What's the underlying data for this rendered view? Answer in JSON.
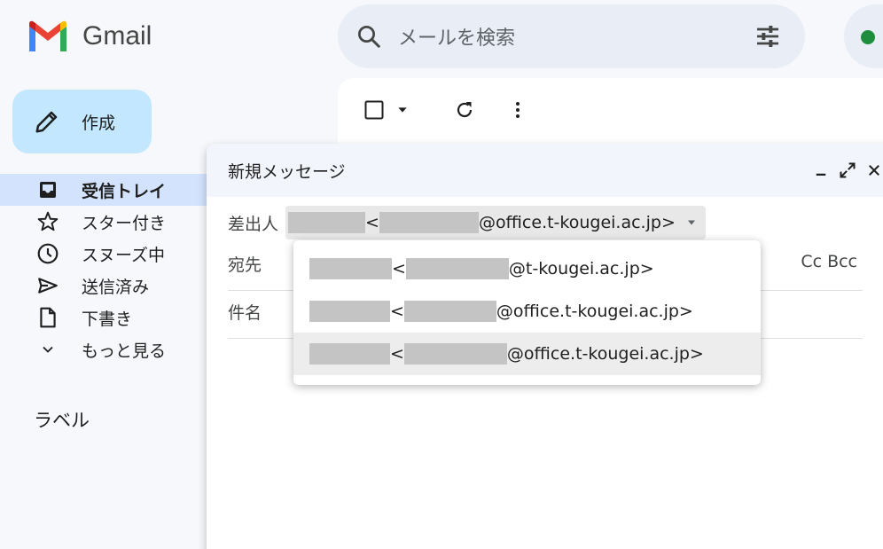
{
  "app": {
    "name": "Gmail"
  },
  "search": {
    "placeholder": "メールを検索"
  },
  "compose_button": {
    "label": "作成"
  },
  "nav": {
    "items": [
      {
        "label": "受信トレイ",
        "icon": "inbox-icon",
        "active": true
      },
      {
        "label": "スター付き",
        "icon": "star-icon"
      },
      {
        "label": "スヌーズ中",
        "icon": "clock-icon"
      },
      {
        "label": "送信済み",
        "icon": "send-icon"
      },
      {
        "label": "下書き",
        "icon": "draft-icon"
      },
      {
        "label": "もっと見る",
        "icon": "chevron-down-icon"
      }
    ],
    "labels_title": "ラベル"
  },
  "compose": {
    "title": "新規メッセージ",
    "from_label": "差出人",
    "from_value_open": "<",
    "from_value_domain": "@office.t-kougei.ac.jp>",
    "to_label": "宛先",
    "cc_bcc": "Cc Bcc",
    "subject_label": "件名"
  },
  "from_options": [
    {
      "open": "<",
      "domain": "@t-kougei.ac.jp>"
    },
    {
      "open": "<",
      "domain": "@office.t-kougei.ac.jp>"
    },
    {
      "open": "<",
      "domain": "@office.t-kougei.ac.jp>"
    }
  ],
  "colors": {
    "accent": "#c2e7ff",
    "active_nav": "#d3e3fd",
    "status_online": "#1e8e3e"
  }
}
